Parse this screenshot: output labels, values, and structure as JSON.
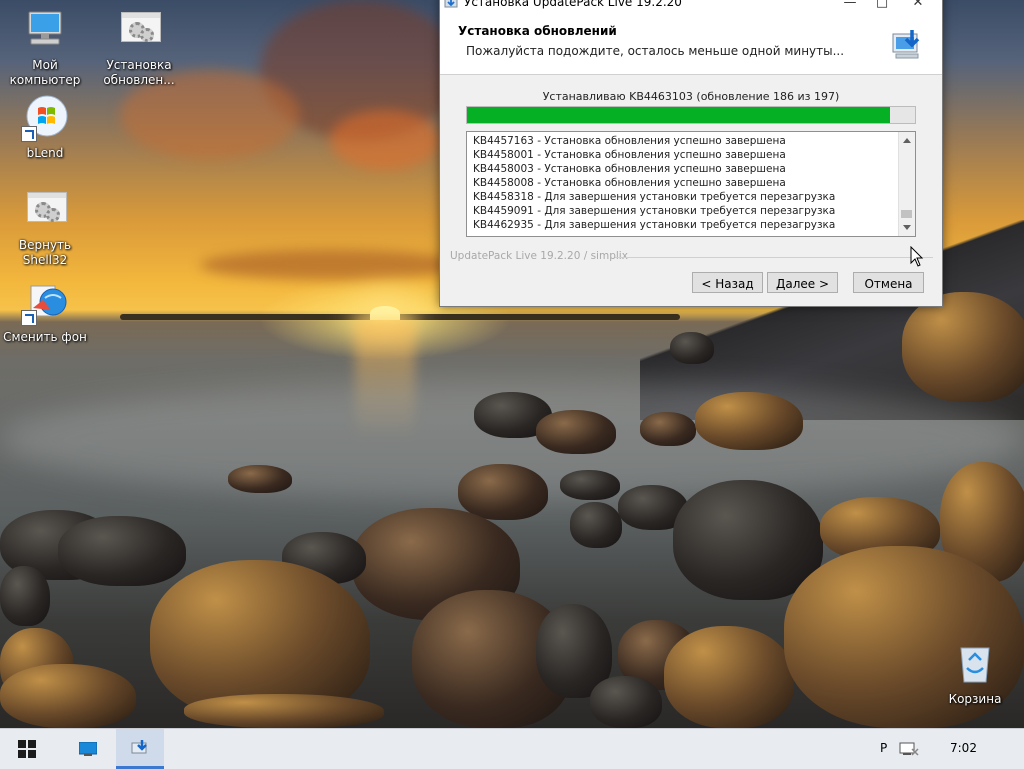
{
  "desktop": {
    "icons": [
      {
        "label": "Мой компьютер"
      },
      {
        "label": "Установка обновлен..."
      },
      {
        "label": "bLend"
      },
      {
        "label": "Вернуть Shell32"
      },
      {
        "label": "Сменить фон"
      },
      {
        "label": "Корзина"
      }
    ]
  },
  "window": {
    "title": "Установка UpdatePack Live 19.2.20",
    "header_title": "Установка обновлений",
    "header_subtitle": "Пожалуйста подождите, осталось меньше одной минуты...",
    "status_text": "Устанавливаю KB4463103 (обновление 186 из 197)",
    "progress_fraction": 0.945,
    "log_lines": [
      "KB4457163 - Установка обновления успешно завершена",
      "KB4458001 - Установка обновления успешно завершена",
      "KB4458003 - Установка обновления успешно завершена",
      "KB4458008 - Установка обновления успешно завершена",
      "KB4458318 - Для завершения установки требуется перезагрузка",
      "KB4459091 - Для завершения установки требуется перезагрузка",
      "KB4462935 - Для завершения установки требуется перезагрузка"
    ],
    "brand_text": "UpdatePack Live 19.2.20 / simplix",
    "buttons": {
      "back": "< Назад",
      "next": "Далее >",
      "cancel": "Отмена"
    },
    "accent_color": "#06b025"
  },
  "taskbar": {
    "tray_lang": "Р",
    "clock": "7:02"
  }
}
